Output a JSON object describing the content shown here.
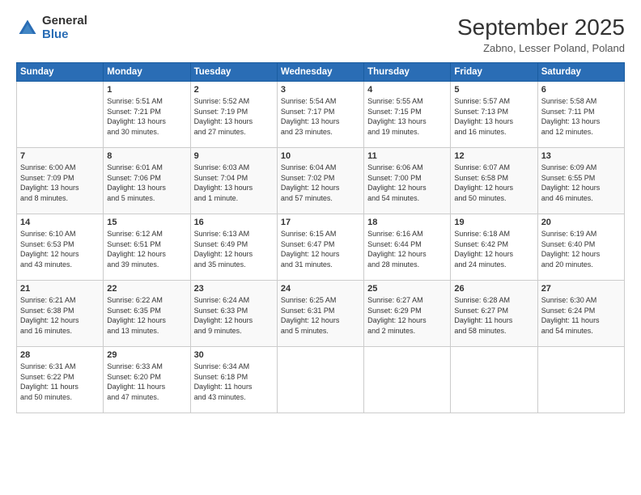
{
  "header": {
    "logo_general": "General",
    "logo_blue": "Blue",
    "month_title": "September 2025",
    "location": "Zabno, Lesser Poland, Poland"
  },
  "days_of_week": [
    "Sunday",
    "Monday",
    "Tuesday",
    "Wednesday",
    "Thursday",
    "Friday",
    "Saturday"
  ],
  "weeks": [
    [
      {
        "day": "",
        "info": ""
      },
      {
        "day": "1",
        "info": "Sunrise: 5:51 AM\nSunset: 7:21 PM\nDaylight: 13 hours\nand 30 minutes."
      },
      {
        "day": "2",
        "info": "Sunrise: 5:52 AM\nSunset: 7:19 PM\nDaylight: 13 hours\nand 27 minutes."
      },
      {
        "day": "3",
        "info": "Sunrise: 5:54 AM\nSunset: 7:17 PM\nDaylight: 13 hours\nand 23 minutes."
      },
      {
        "day": "4",
        "info": "Sunrise: 5:55 AM\nSunset: 7:15 PM\nDaylight: 13 hours\nand 19 minutes."
      },
      {
        "day": "5",
        "info": "Sunrise: 5:57 AM\nSunset: 7:13 PM\nDaylight: 13 hours\nand 16 minutes."
      },
      {
        "day": "6",
        "info": "Sunrise: 5:58 AM\nSunset: 7:11 PM\nDaylight: 13 hours\nand 12 minutes."
      }
    ],
    [
      {
        "day": "7",
        "info": "Sunrise: 6:00 AM\nSunset: 7:09 PM\nDaylight: 13 hours\nand 8 minutes."
      },
      {
        "day": "8",
        "info": "Sunrise: 6:01 AM\nSunset: 7:06 PM\nDaylight: 13 hours\nand 5 minutes."
      },
      {
        "day": "9",
        "info": "Sunrise: 6:03 AM\nSunset: 7:04 PM\nDaylight: 13 hours\nand 1 minute."
      },
      {
        "day": "10",
        "info": "Sunrise: 6:04 AM\nSunset: 7:02 PM\nDaylight: 12 hours\nand 57 minutes."
      },
      {
        "day": "11",
        "info": "Sunrise: 6:06 AM\nSunset: 7:00 PM\nDaylight: 12 hours\nand 54 minutes."
      },
      {
        "day": "12",
        "info": "Sunrise: 6:07 AM\nSunset: 6:58 PM\nDaylight: 12 hours\nand 50 minutes."
      },
      {
        "day": "13",
        "info": "Sunrise: 6:09 AM\nSunset: 6:55 PM\nDaylight: 12 hours\nand 46 minutes."
      }
    ],
    [
      {
        "day": "14",
        "info": "Sunrise: 6:10 AM\nSunset: 6:53 PM\nDaylight: 12 hours\nand 43 minutes."
      },
      {
        "day": "15",
        "info": "Sunrise: 6:12 AM\nSunset: 6:51 PM\nDaylight: 12 hours\nand 39 minutes."
      },
      {
        "day": "16",
        "info": "Sunrise: 6:13 AM\nSunset: 6:49 PM\nDaylight: 12 hours\nand 35 minutes."
      },
      {
        "day": "17",
        "info": "Sunrise: 6:15 AM\nSunset: 6:47 PM\nDaylight: 12 hours\nand 31 minutes."
      },
      {
        "day": "18",
        "info": "Sunrise: 6:16 AM\nSunset: 6:44 PM\nDaylight: 12 hours\nand 28 minutes."
      },
      {
        "day": "19",
        "info": "Sunrise: 6:18 AM\nSunset: 6:42 PM\nDaylight: 12 hours\nand 24 minutes."
      },
      {
        "day": "20",
        "info": "Sunrise: 6:19 AM\nSunset: 6:40 PM\nDaylight: 12 hours\nand 20 minutes."
      }
    ],
    [
      {
        "day": "21",
        "info": "Sunrise: 6:21 AM\nSunset: 6:38 PM\nDaylight: 12 hours\nand 16 minutes."
      },
      {
        "day": "22",
        "info": "Sunrise: 6:22 AM\nSunset: 6:35 PM\nDaylight: 12 hours\nand 13 minutes."
      },
      {
        "day": "23",
        "info": "Sunrise: 6:24 AM\nSunset: 6:33 PM\nDaylight: 12 hours\nand 9 minutes."
      },
      {
        "day": "24",
        "info": "Sunrise: 6:25 AM\nSunset: 6:31 PM\nDaylight: 12 hours\nand 5 minutes."
      },
      {
        "day": "25",
        "info": "Sunrise: 6:27 AM\nSunset: 6:29 PM\nDaylight: 12 hours\nand 2 minutes."
      },
      {
        "day": "26",
        "info": "Sunrise: 6:28 AM\nSunset: 6:27 PM\nDaylight: 11 hours\nand 58 minutes."
      },
      {
        "day": "27",
        "info": "Sunrise: 6:30 AM\nSunset: 6:24 PM\nDaylight: 11 hours\nand 54 minutes."
      }
    ],
    [
      {
        "day": "28",
        "info": "Sunrise: 6:31 AM\nSunset: 6:22 PM\nDaylight: 11 hours\nand 50 minutes."
      },
      {
        "day": "29",
        "info": "Sunrise: 6:33 AM\nSunset: 6:20 PM\nDaylight: 11 hours\nand 47 minutes."
      },
      {
        "day": "30",
        "info": "Sunrise: 6:34 AM\nSunset: 6:18 PM\nDaylight: 11 hours\nand 43 minutes."
      },
      {
        "day": "",
        "info": ""
      },
      {
        "day": "",
        "info": ""
      },
      {
        "day": "",
        "info": ""
      },
      {
        "day": "",
        "info": ""
      }
    ]
  ]
}
